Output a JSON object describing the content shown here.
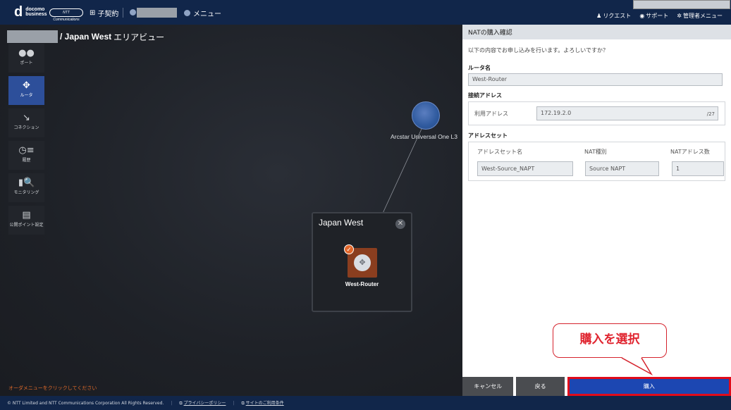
{
  "header": {
    "logo_mark": "d",
    "logo_line1": "docomo",
    "logo_line2": "business",
    "ntt_badge": "NTT Communications",
    "contract_label": "子契約",
    "menu_label": "メニュー",
    "links": [
      "リクエスト",
      "サポート",
      "管理者メニュー"
    ]
  },
  "breadcrumb": {
    "area": "/ Japan West",
    "suffix": "エリアビュー"
  },
  "sidebar": {
    "items": [
      {
        "label": "ポート",
        "icon": "port-icon"
      },
      {
        "label": "ルータ",
        "icon": "router-icon",
        "active": true
      },
      {
        "label": "コネクション",
        "icon": "connection-icon"
      },
      {
        "label": "履歴",
        "icon": "history-icon"
      },
      {
        "label": "モニタリング",
        "icon": "monitoring-icon"
      },
      {
        "label": "公開ポイント設定",
        "icon": "public-point-icon"
      }
    ]
  },
  "canvas": {
    "external_node": "Arcstar Universal One L3",
    "area_box_title": "Japan West",
    "router_name": "West-Router",
    "order_hint": "オーダメニューをクリックしてください"
  },
  "panel": {
    "title": "NATの購入確認",
    "message": "以下の内容でお申し込みを行います。よろしいですか？",
    "router_label": "ルータ名",
    "router_value": "West-Router",
    "connect_label": "接続アドレス",
    "use_address_label": "利用アドレス",
    "use_address_value": "172.19.2.0",
    "prefix": "/27",
    "address_set_label": "アドレスセット",
    "col_name": "アドレスセット名",
    "col_type": "NAT種別",
    "col_count": "NATアドレス数",
    "name_value": "West-Source_NAPT",
    "type_value": "Source NAPT",
    "count_value": "1",
    "cancel_btn": "キャンセル",
    "back_btn": "戻る",
    "buy_btn": "購入"
  },
  "callout": "購入を選択",
  "footer": {
    "copyright": "© NTT Limited and NTT Communications Corporation All Rights Reserved.",
    "privacy": "プライバシーポリシー",
    "terms": "サイトのご利用条件"
  },
  "colors": {
    "header_bg": "#11264a",
    "accent_blue": "#1c47b2",
    "highlight_red": "#e10b1a",
    "router_orange": "#8a3e1f"
  }
}
